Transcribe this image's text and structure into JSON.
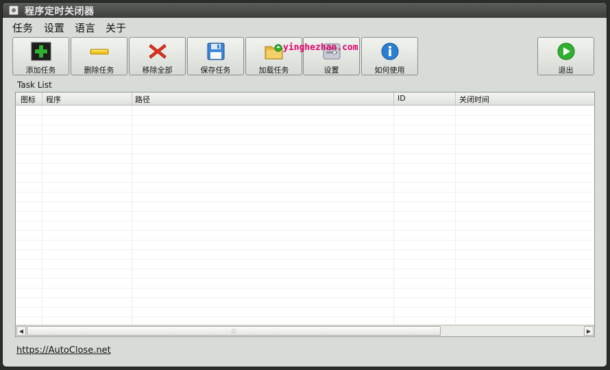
{
  "window": {
    "title": "程序定时关闭器"
  },
  "menu": [
    "任务",
    "设置",
    "语言",
    "关于"
  ],
  "toolbar": [
    {
      "label": "添加任务",
      "icon": "add-icon"
    },
    {
      "label": "删除任务",
      "icon": "remove-icon"
    },
    {
      "label": "移除全部",
      "icon": "delete-all-icon"
    },
    {
      "label": "保存任务",
      "icon": "save-icon"
    },
    {
      "label": "加载任务",
      "icon": "load-folder-icon"
    },
    {
      "label": "设置",
      "icon": "settings-icon"
    },
    {
      "label": "如何使用",
      "icon": "info-icon"
    },
    {
      "label": "退出",
      "icon": "exit-icon"
    }
  ],
  "watermark": "yinghezhan.com",
  "task_list": {
    "label": "Task List",
    "columns": [
      "图标",
      "程序",
      "路径",
      "ID",
      "关闭时间"
    ],
    "rows": []
  },
  "footer": {
    "link": "https://AutoClose.net"
  },
  "colors": {
    "accent_green": "#2fb12f",
    "error_red": "#e8321e",
    "info_blue": "#2a7fd4",
    "watermark": "#e0006a"
  }
}
